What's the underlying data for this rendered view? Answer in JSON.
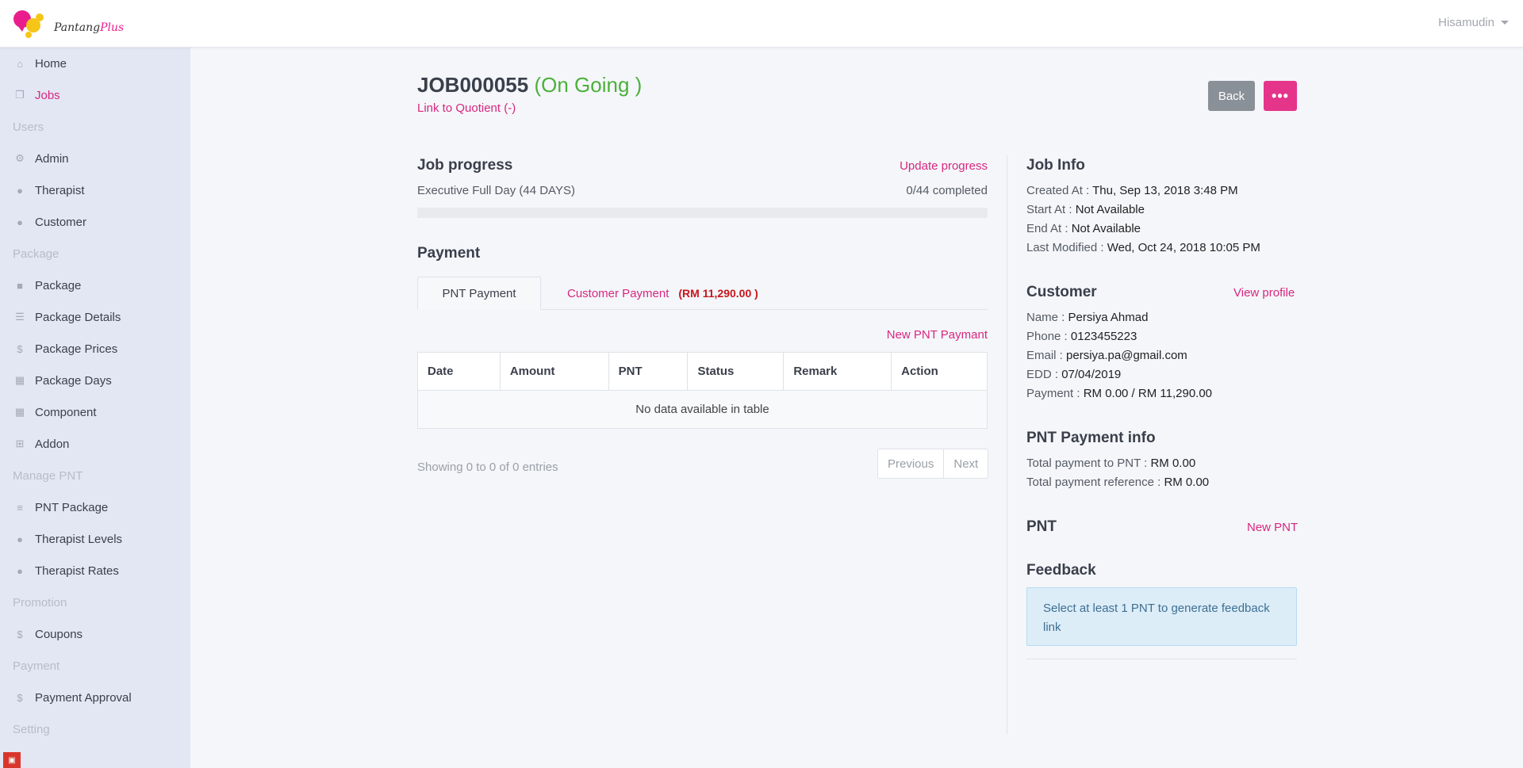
{
  "header": {
    "logo_text_dark": "Pantang",
    "logo_text_pink": "Plus",
    "user_name": "Hisamudin"
  },
  "sidebar": {
    "items": [
      {
        "type": "item",
        "label": "Home",
        "icon": "home-icon",
        "active": false
      },
      {
        "type": "item",
        "label": "Jobs",
        "icon": "copy-icon",
        "active": true
      },
      {
        "type": "section",
        "label": "Users"
      },
      {
        "type": "item",
        "label": "Admin",
        "icon": "user-cog-icon",
        "active": false
      },
      {
        "type": "item",
        "label": "Therapist",
        "icon": "user-icon",
        "active": false
      },
      {
        "type": "item",
        "label": "Customer",
        "icon": "user-icon",
        "active": false
      },
      {
        "type": "section",
        "label": "Package"
      },
      {
        "type": "item",
        "label": "Package",
        "icon": "square-icon",
        "active": false
      },
      {
        "type": "item",
        "label": "Package Details",
        "icon": "list-icon",
        "active": false
      },
      {
        "type": "item",
        "label": "Package Prices",
        "icon": "dollar-icon",
        "active": false
      },
      {
        "type": "item",
        "label": "Package Days",
        "icon": "calendar-icon",
        "active": false
      },
      {
        "type": "item",
        "label": "Component",
        "icon": "grid-icon",
        "active": false
      },
      {
        "type": "item",
        "label": "Addon",
        "icon": "plus-square-icon",
        "active": false
      },
      {
        "type": "section",
        "label": "Manage PNT"
      },
      {
        "type": "item",
        "label": "PNT Package",
        "icon": "sliders-icon",
        "active": false
      },
      {
        "type": "item",
        "label": "Therapist Levels",
        "icon": "user-icon",
        "active": false
      },
      {
        "type": "item",
        "label": "Therapist Rates",
        "icon": "user-icon",
        "active": false
      },
      {
        "type": "section",
        "label": "Promotion"
      },
      {
        "type": "item",
        "label": "Coupons",
        "icon": "dollar-icon",
        "active": false
      },
      {
        "type": "section",
        "label": "Payment"
      },
      {
        "type": "item",
        "label": "Payment Approval",
        "icon": "dollar-icon",
        "active": false
      },
      {
        "type": "section",
        "label": "Setting"
      }
    ]
  },
  "job": {
    "id": "JOB000055",
    "status": "(On Going )",
    "quotient_link": "Link to Quotient (-)",
    "back_label": "Back",
    "more_label": "•••"
  },
  "progress": {
    "title": "Job progress",
    "update_link": "Update progress",
    "package": "Executive Full Day (44 DAYS)",
    "completed_text": "0/44 completed",
    "fraction": 0
  },
  "payment": {
    "title": "Payment",
    "tab_pnt": "PNT Payment",
    "tab_customer": "Customer Payment",
    "tab_customer_amount": "(RM 11,290.00 )",
    "new_link": "New PNT Paymant",
    "columns": [
      "Date",
      "Amount",
      "PNT",
      "Status",
      "Remark",
      "Action"
    ],
    "empty_text": "No data available in table",
    "entries_text": "Showing 0 to 0 of 0 entries",
    "prev_label": "Previous",
    "next_label": "Next"
  },
  "job_info": {
    "title": "Job Info",
    "rows": [
      {
        "key": "Created At :",
        "value": "Thu, Sep 13, 2018 3:48 PM"
      },
      {
        "key": "Start At :",
        "value": "Not Available"
      },
      {
        "key": "End At :",
        "value": "Not Available"
      },
      {
        "key": "Last Modified :",
        "value": "Wed, Oct 24, 2018 10:05 PM"
      }
    ]
  },
  "customer": {
    "title": "Customer",
    "view_link": "View profile",
    "rows": [
      {
        "key": "Name :",
        "value": "Persiya Ahmad"
      },
      {
        "key": "Phone :",
        "value": "0123455223"
      },
      {
        "key": "Email :",
        "value": "persiya.pa@gmail.com"
      },
      {
        "key": "EDD :",
        "value": "07/04/2019"
      },
      {
        "key": "Payment :",
        "value": "RM 0.00 / RM 11,290.00"
      }
    ]
  },
  "pnt_payment_info": {
    "title": "PNT Payment info",
    "rows": [
      {
        "key": "Total payment to PNT :",
        "value": "RM 0.00"
      },
      {
        "key": "Total payment reference :",
        "value": "RM 0.00"
      }
    ]
  },
  "pnt": {
    "title": "PNT",
    "new_link": "New PNT"
  },
  "feedback": {
    "title": "Feedback",
    "alert_text": "Select at least 1 PNT to generate feedback link"
  },
  "colors": {
    "accent": "#e4358a",
    "status_green": "#4cb03a",
    "amount_red": "#c8161d",
    "sidebar_bg": "#e3e7f4"
  }
}
